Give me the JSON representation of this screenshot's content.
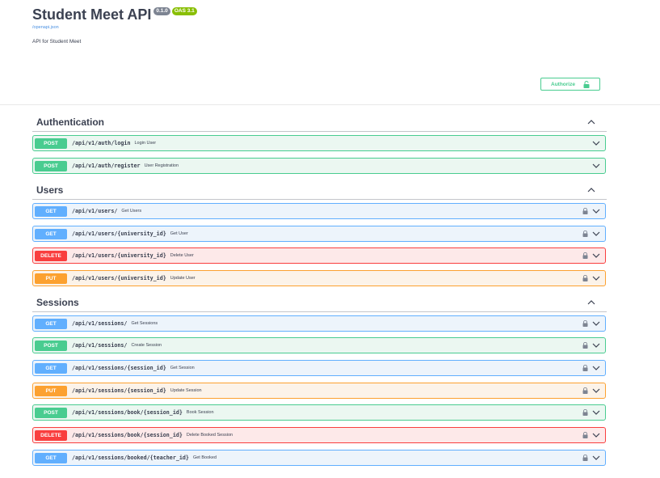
{
  "info": {
    "title": "Student Meet API",
    "version": "0.1.0",
    "oas": "OAS 3.1",
    "spec_link": "/openapi.json",
    "description": "API for Student Meet"
  },
  "authorize_label": "Authorize",
  "colors": {
    "post": "#49cc90",
    "get": "#61affe",
    "delete": "#f93e3e",
    "put": "#fca130"
  },
  "sections": [
    {
      "name": "Authentication",
      "operations": [
        {
          "method": "POST",
          "path": "/api/v1/auth/login",
          "summary": "Login User"
        },
        {
          "method": "POST",
          "path": "/api/v1/auth/register",
          "summary": "User Registration"
        }
      ]
    },
    {
      "name": "Users",
      "operations": [
        {
          "method": "GET",
          "path": "/api/v1/users/",
          "summary": "Get Users"
        },
        {
          "method": "GET",
          "path": "/api/v1/users/{university_id}",
          "summary": "Get User"
        },
        {
          "method": "DELETE",
          "path": "/api/v1/users/{university_id}",
          "summary": "Delete User"
        },
        {
          "method": "PUT",
          "path": "/api/v1/users/{university_id}",
          "summary": "Update User"
        }
      ]
    },
    {
      "name": "Sessions",
      "operations": [
        {
          "method": "GET",
          "path": "/api/v1/sessions/",
          "summary": "Get Sessions"
        },
        {
          "method": "POST",
          "path": "/api/v1/sessions/",
          "summary": "Create Session"
        },
        {
          "method": "GET",
          "path": "/api/v1/sessions/{session_id}",
          "summary": "Get Session"
        },
        {
          "method": "PUT",
          "path": "/api/v1/sessions/{session_id}",
          "summary": "Update Session"
        },
        {
          "method": "POST",
          "path": "/api/v1/sessions/book/{session_id}",
          "summary": "Book Session"
        },
        {
          "method": "DELETE",
          "path": "/api/v1/sessions/book/{session_id}",
          "summary": "Delete Booked Session"
        },
        {
          "method": "GET",
          "path": "/api/v1/sessions/booked/{teacher_id}",
          "summary": "Get Booked"
        }
      ]
    }
  ]
}
